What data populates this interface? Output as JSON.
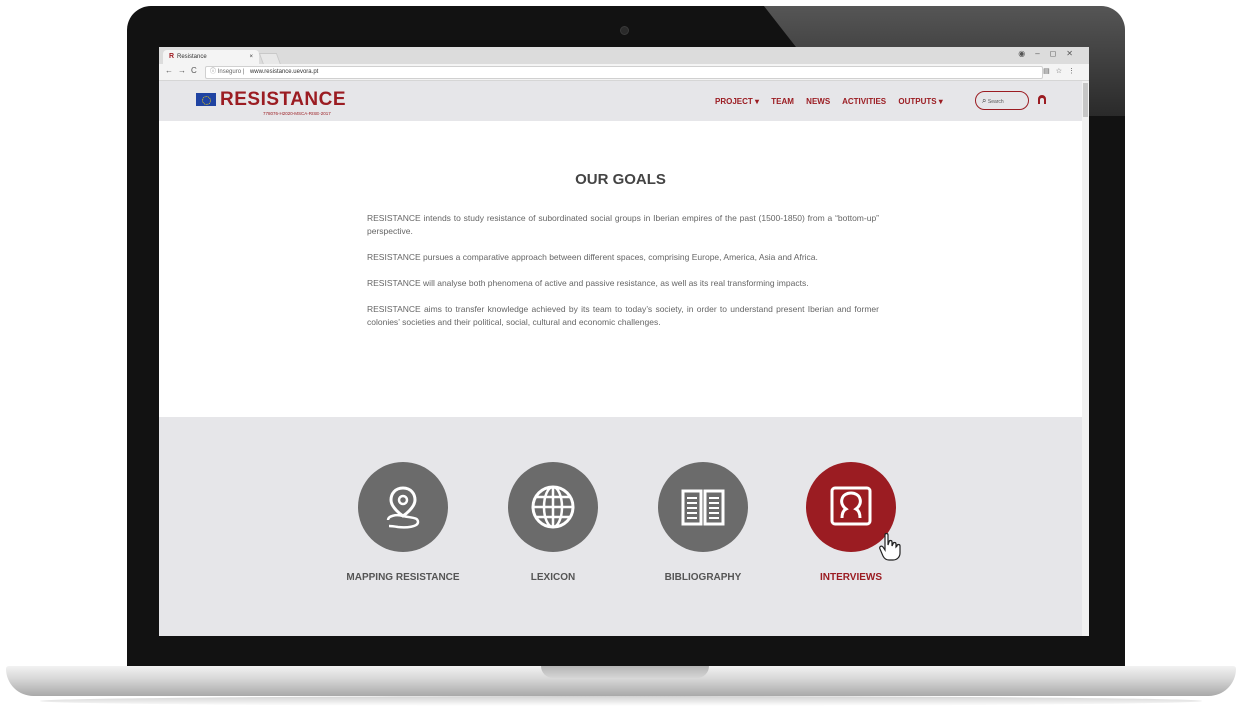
{
  "browser": {
    "tab_title": "Resistance",
    "tab_favicon": "R",
    "tab_close": "×",
    "security": "Inseguro",
    "url": "www.resistance.uevora.pt"
  },
  "site": {
    "logo_text": "RESISTANCE",
    "grant": "778076-H2020-MSCA-RISE-2017",
    "nav": [
      "PROJECT ▾",
      "TEAM",
      "NEWS",
      "ACTIVITIES",
      "OUTPUTS ▾"
    ],
    "search_placeholder": "Search"
  },
  "main": {
    "title": "OUR GOALS",
    "paragraphs": [
      "RESISTANCE intends to study resistance of subordinated social groups in Iberian empires of the past (1500-1850) from a “bottom-up” perspective.",
      "RESISTANCE pursues a comparative approach between different spaces, comprising Europe, America, Asia and Africa.",
      "RESISTANCE will analyse both phenomena of active and passive resistance, as well as its real transforming impacts.",
      "RESISTANCE aims to transfer knowledge achieved by its team to today’s society, in order to understand present Iberian and former colonies’ societies and their political, social, cultural and economic challenges."
    ]
  },
  "tiles": [
    {
      "label": "MAPPING RESISTANCE",
      "icon": "map-pin-icon",
      "active": false
    },
    {
      "label": "LEXICON",
      "icon": "globe-icon",
      "active": false
    },
    {
      "label": "BIBLIOGRAPHY",
      "icon": "book-icon",
      "active": false
    },
    {
      "label": "INTERVIEWS",
      "icon": "interview-icon",
      "active": true
    }
  ],
  "colors": {
    "brand_red": "#9b1c22",
    "tile_gray": "#6b6b6b",
    "band_bg": "#e6e6e9"
  }
}
